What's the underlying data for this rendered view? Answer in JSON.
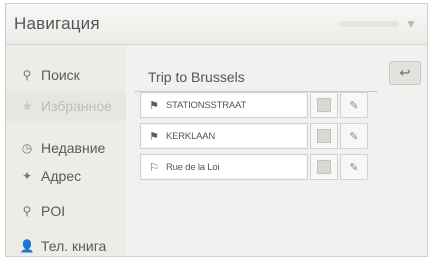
{
  "header": {
    "title": "Навигация"
  },
  "sidebar": {
    "items": [
      {
        "label": "Поиск",
        "icon": "search-icon",
        "glyph": "⚲"
      },
      {
        "label": "Избранное",
        "icon": "star-icon",
        "glyph": "★"
      },
      {
        "label": "Недавние",
        "icon": "recent-icon",
        "glyph": "◷"
      },
      {
        "label": "Адрес",
        "icon": "address-icon",
        "glyph": "✦"
      },
      {
        "label": "POI",
        "icon": "poi-icon",
        "glyph": "⚲"
      },
      {
        "label": "Тел. книга",
        "icon": "phonebook-icon",
        "glyph": "👤"
      }
    ]
  },
  "main": {
    "trip_title": "Trip to Brussels",
    "back_glyph": "↩",
    "destinations": [
      {
        "name": "STATIONSSTRAAT",
        "icon": "flag-icon",
        "glyph": "⚑"
      },
      {
        "name": "KERKLAAN",
        "icon": "flag-icon",
        "glyph": "⚑"
      },
      {
        "name": "Rue de la Loi",
        "icon": "flag-icon",
        "glyph": "⚐"
      }
    ],
    "edit_glyph": "✎"
  },
  "colors": {
    "background": "#f1f1ef",
    "sidebar": "#ecece9",
    "text": "#555555",
    "dim_text": "#bdbdbb"
  }
}
